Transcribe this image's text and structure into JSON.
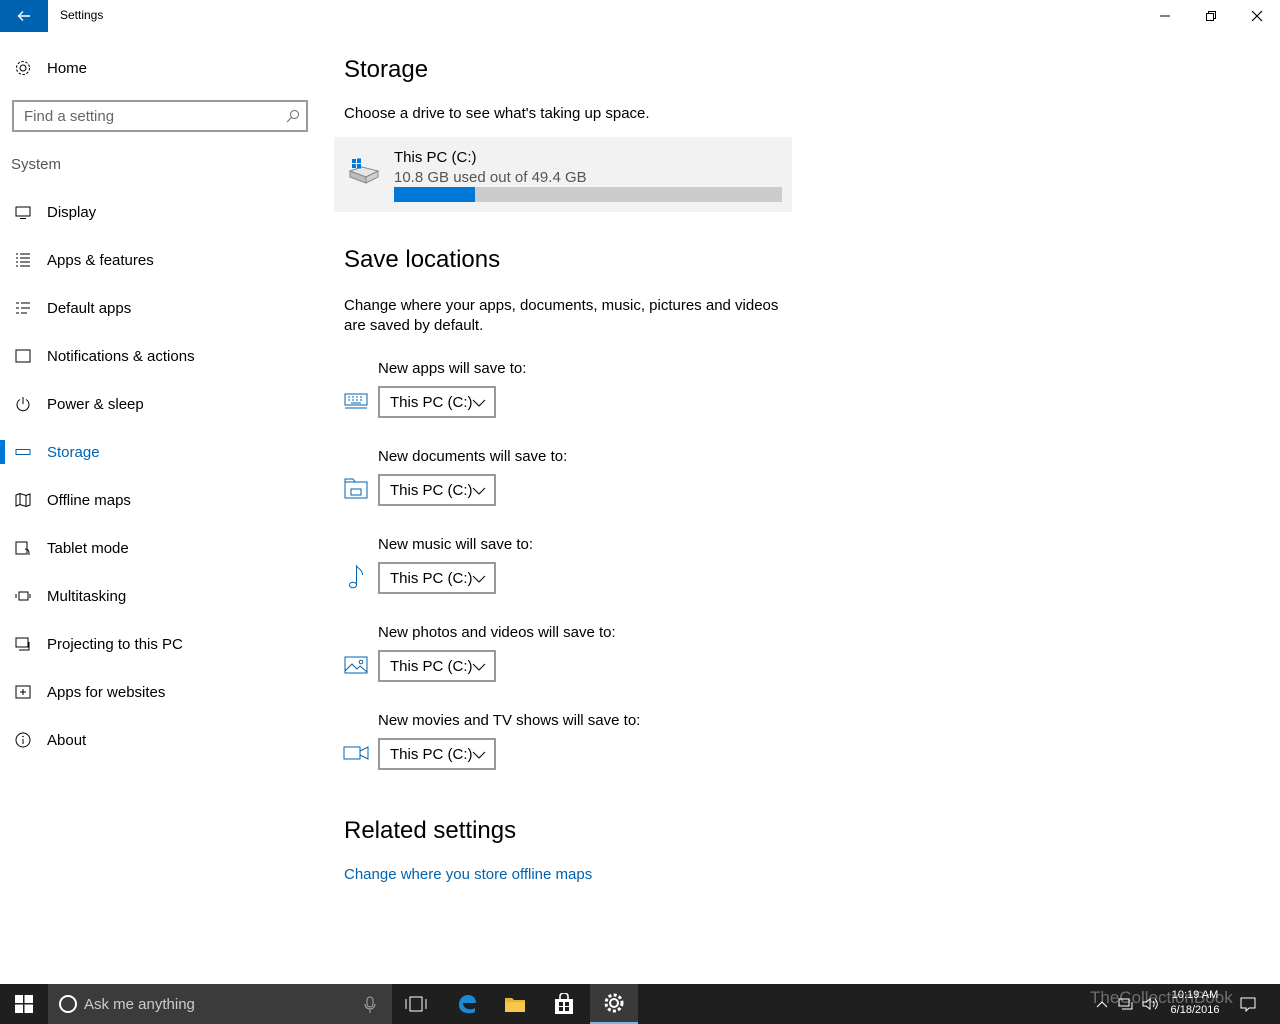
{
  "window": {
    "title": "Settings"
  },
  "sidebar": {
    "home_label": "Home",
    "search_placeholder": "Find a setting",
    "section": "System",
    "items": [
      {
        "label": "Display",
        "icon": "display-icon"
      },
      {
        "label": "Apps & features",
        "icon": "list-icon"
      },
      {
        "label": "Default apps",
        "icon": "default-apps-icon"
      },
      {
        "label": "Notifications & actions",
        "icon": "notification-icon"
      },
      {
        "label": "Power & sleep",
        "icon": "power-icon"
      },
      {
        "label": "Storage",
        "icon": "storage-icon",
        "active": true
      },
      {
        "label": "Offline maps",
        "icon": "map-icon"
      },
      {
        "label": "Tablet mode",
        "icon": "tablet-icon"
      },
      {
        "label": "Multitasking",
        "icon": "multitasking-icon"
      },
      {
        "label": "Projecting to this PC",
        "icon": "projecting-icon"
      },
      {
        "label": "Apps for websites",
        "icon": "apps-websites-icon"
      },
      {
        "label": "About",
        "icon": "info-icon"
      }
    ]
  },
  "storage": {
    "title": "Storage",
    "description": "Choose a drive to see what's taking up space.",
    "drive": {
      "name": "This PC (C:)",
      "usage": "10.8 GB used out of 49.4 GB",
      "used_fraction": 0.21
    }
  },
  "save_locations": {
    "title": "Save locations",
    "description": "Change where your apps, documents, music, pictures and videos are saved by default.",
    "items": [
      {
        "label": "New apps will save to:",
        "value": "This PC (C:)",
        "icon": "keyboard-icon"
      },
      {
        "label": "New documents will save to:",
        "value": "This PC (C:)",
        "icon": "documents-icon"
      },
      {
        "label": "New music will save to:",
        "value": "This PC (C:)",
        "icon": "music-icon"
      },
      {
        "label": "New photos and videos will save to:",
        "value": "This PC (C:)",
        "icon": "photo-icon"
      },
      {
        "label": "New movies and TV shows will save to:",
        "value": "This PC (C:)",
        "icon": "video-camera-icon"
      }
    ]
  },
  "related": {
    "title": "Related settings",
    "link": "Change where you store offline maps"
  },
  "taskbar": {
    "search_placeholder": "Ask me anything",
    "time": "10:19 AM",
    "date": "6/18/2016",
    "watermark": "TheCollectionBook"
  },
  "colors": {
    "accent": "#0078d7",
    "link": "#0063b1",
    "taskbar": "#1f1f1f"
  }
}
